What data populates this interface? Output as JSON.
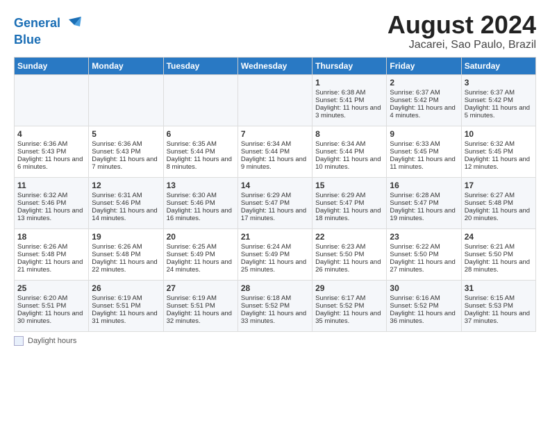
{
  "logo": {
    "line1": "General",
    "line2": "Blue"
  },
  "title": "August 2024",
  "subtitle": "Jacarei, Sao Paulo, Brazil",
  "days_of_week": [
    "Sunday",
    "Monday",
    "Tuesday",
    "Wednesday",
    "Thursday",
    "Friday",
    "Saturday"
  ],
  "weeks": [
    [
      {
        "day": "",
        "info": ""
      },
      {
        "day": "",
        "info": ""
      },
      {
        "day": "",
        "info": ""
      },
      {
        "day": "",
        "info": ""
      },
      {
        "day": "1",
        "info": "Sunrise: 6:38 AM\nSunset: 5:41 PM\nDaylight: 11 hours and 3 minutes."
      },
      {
        "day": "2",
        "info": "Sunrise: 6:37 AM\nSunset: 5:42 PM\nDaylight: 11 hours and 4 minutes."
      },
      {
        "day": "3",
        "info": "Sunrise: 6:37 AM\nSunset: 5:42 PM\nDaylight: 11 hours and 5 minutes."
      }
    ],
    [
      {
        "day": "4",
        "info": "Sunrise: 6:36 AM\nSunset: 5:43 PM\nDaylight: 11 hours and 6 minutes."
      },
      {
        "day": "5",
        "info": "Sunrise: 6:36 AM\nSunset: 5:43 PM\nDaylight: 11 hours and 7 minutes."
      },
      {
        "day": "6",
        "info": "Sunrise: 6:35 AM\nSunset: 5:44 PM\nDaylight: 11 hours and 8 minutes."
      },
      {
        "day": "7",
        "info": "Sunrise: 6:34 AM\nSunset: 5:44 PM\nDaylight: 11 hours and 9 minutes."
      },
      {
        "day": "8",
        "info": "Sunrise: 6:34 AM\nSunset: 5:44 PM\nDaylight: 11 hours and 10 minutes."
      },
      {
        "day": "9",
        "info": "Sunrise: 6:33 AM\nSunset: 5:45 PM\nDaylight: 11 hours and 11 minutes."
      },
      {
        "day": "10",
        "info": "Sunrise: 6:32 AM\nSunset: 5:45 PM\nDaylight: 11 hours and 12 minutes."
      }
    ],
    [
      {
        "day": "11",
        "info": "Sunrise: 6:32 AM\nSunset: 5:46 PM\nDaylight: 11 hours and 13 minutes."
      },
      {
        "day": "12",
        "info": "Sunrise: 6:31 AM\nSunset: 5:46 PM\nDaylight: 11 hours and 14 minutes."
      },
      {
        "day": "13",
        "info": "Sunrise: 6:30 AM\nSunset: 5:46 PM\nDaylight: 11 hours and 16 minutes."
      },
      {
        "day": "14",
        "info": "Sunrise: 6:29 AM\nSunset: 5:47 PM\nDaylight: 11 hours and 17 minutes."
      },
      {
        "day": "15",
        "info": "Sunrise: 6:29 AM\nSunset: 5:47 PM\nDaylight: 11 hours and 18 minutes."
      },
      {
        "day": "16",
        "info": "Sunrise: 6:28 AM\nSunset: 5:47 PM\nDaylight: 11 hours and 19 minutes."
      },
      {
        "day": "17",
        "info": "Sunrise: 6:27 AM\nSunset: 5:48 PM\nDaylight: 11 hours and 20 minutes."
      }
    ],
    [
      {
        "day": "18",
        "info": "Sunrise: 6:26 AM\nSunset: 5:48 PM\nDaylight: 11 hours and 21 minutes."
      },
      {
        "day": "19",
        "info": "Sunrise: 6:26 AM\nSunset: 5:48 PM\nDaylight: 11 hours and 22 minutes."
      },
      {
        "day": "20",
        "info": "Sunrise: 6:25 AM\nSunset: 5:49 PM\nDaylight: 11 hours and 24 minutes."
      },
      {
        "day": "21",
        "info": "Sunrise: 6:24 AM\nSunset: 5:49 PM\nDaylight: 11 hours and 25 minutes."
      },
      {
        "day": "22",
        "info": "Sunrise: 6:23 AM\nSunset: 5:50 PM\nDaylight: 11 hours and 26 minutes."
      },
      {
        "day": "23",
        "info": "Sunrise: 6:22 AM\nSunset: 5:50 PM\nDaylight: 11 hours and 27 minutes."
      },
      {
        "day": "24",
        "info": "Sunrise: 6:21 AM\nSunset: 5:50 PM\nDaylight: 11 hours and 28 minutes."
      }
    ],
    [
      {
        "day": "25",
        "info": "Sunrise: 6:20 AM\nSunset: 5:51 PM\nDaylight: 11 hours and 30 minutes."
      },
      {
        "day": "26",
        "info": "Sunrise: 6:19 AM\nSunset: 5:51 PM\nDaylight: 11 hours and 31 minutes."
      },
      {
        "day": "27",
        "info": "Sunrise: 6:19 AM\nSunset: 5:51 PM\nDaylight: 11 hours and 32 minutes."
      },
      {
        "day": "28",
        "info": "Sunrise: 6:18 AM\nSunset: 5:52 PM\nDaylight: 11 hours and 33 minutes."
      },
      {
        "day": "29",
        "info": "Sunrise: 6:17 AM\nSunset: 5:52 PM\nDaylight: 11 hours and 35 minutes."
      },
      {
        "day": "30",
        "info": "Sunrise: 6:16 AM\nSunset: 5:52 PM\nDaylight: 11 hours and 36 minutes."
      },
      {
        "day": "31",
        "info": "Sunrise: 6:15 AM\nSunset: 5:53 PM\nDaylight: 11 hours and 37 minutes."
      }
    ]
  ],
  "footer": {
    "legend_label": "Daylight hours"
  }
}
